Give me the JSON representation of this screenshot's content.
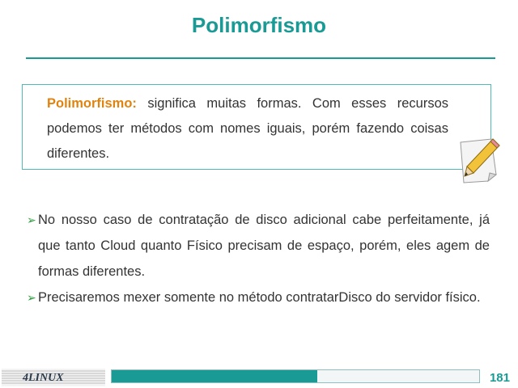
{
  "slide": {
    "title": "Polimorfismo",
    "definition": {
      "term": "Polimorfismo:",
      "text": " significa muitas formas. Com esses recursos podemos ter métodos com nomes iguais, porém fazendo coisas diferentes."
    },
    "bullets": [
      "No nosso caso de contratação de disco adicional cabe perfeitamente, já que tanto Cloud quanto Físico precisam de espaço, porém, eles agem de formas diferentes.",
      "Precisaremos mexer somente no método contratarDisco do servidor físico."
    ],
    "bullet_marker": "➢",
    "icon": "pencil-note-icon"
  },
  "footer": {
    "logo": "4LINUX",
    "page_number": "181",
    "progress_fraction": 0.56,
    "colors": {
      "accent": "#1a9a94",
      "term": "#e0830f",
      "bullet": "#2a9a3a"
    }
  }
}
